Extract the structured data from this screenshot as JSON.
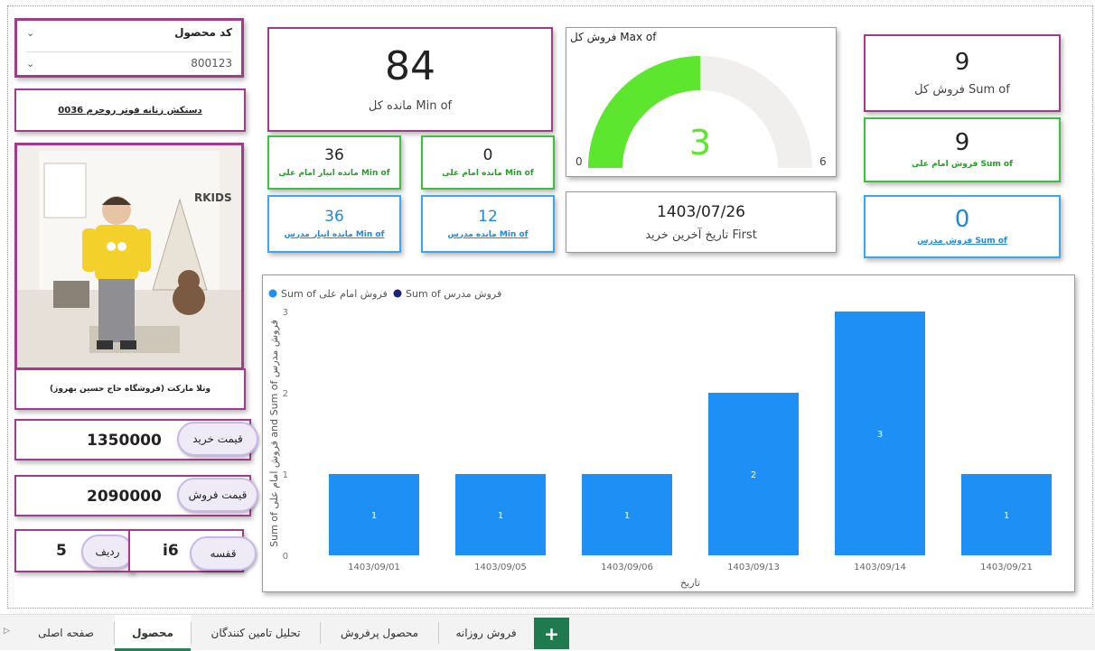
{
  "slicer": {
    "title": "کد محصول",
    "value": "800123"
  },
  "product": {
    "name": "دستکش زنانه فوتر روجرم 0036",
    "caption": "وتلا مارکت (فروشگاه حاج حسین بهروز)",
    "brand_text": "RKIDS"
  },
  "prices": {
    "buy_label": "قیمت خرید",
    "buy_value": "1350000",
    "sell_label": "قیمت فروش",
    "sell_value": "2090000"
  },
  "location": {
    "shelf_label": "قفسه",
    "shelf_value": "i6",
    "row_label": "ردیف",
    "row_value": "5"
  },
  "kpis": {
    "total_stock": {
      "value": "84",
      "label": "Min of مانده کل"
    },
    "stock_warehouse_ali": {
      "value": "36",
      "label": "Min of مانده انبار امام علی"
    },
    "stock_ali": {
      "value": "0",
      "label": "Min of مانده امام علی"
    },
    "stock_warehouse_modarres": {
      "value": "36",
      "label": "Min of مانده انبار مدرس"
    },
    "stock_modarres": {
      "value": "12",
      "label": "Min of مانده مدرس"
    },
    "total_sales": {
      "value": "9",
      "label": "Sum of فروش کل"
    },
    "sales_ali": {
      "value": "9",
      "label": "Sum of فروش امام علی"
    },
    "sales_modarres": {
      "value": "0",
      "label": "Sum of فروش مدرس"
    },
    "last_purchase": {
      "value": "1403/07/26",
      "label": "First تاریخ آخرین خرید"
    }
  },
  "gauge": {
    "title": "Max of فروش کل",
    "value": 3,
    "value_label": "3",
    "min": 0,
    "min_label": "0",
    "max": 6,
    "max_label": "6",
    "fill_color": "#5ce62e",
    "track_color": "#f0efee"
  },
  "chart_data": {
    "type": "bar",
    "legend": [
      {
        "name": "Sum of فروش امام علی",
        "color": "#1e8ff5"
      },
      {
        "name": "Sum of فروش مدرس",
        "color": "#1a237e"
      }
    ],
    "categories": [
      "1403/09/01",
      "1403/09/05",
      "1403/09/06",
      "1403/09/13",
      "1403/09/14",
      "1403/09/21"
    ],
    "series": [
      {
        "name": "Sum of فروش امام علی",
        "values": [
          1,
          1,
          1,
          2,
          3,
          1
        ]
      }
    ],
    "value_labels": [
      "1",
      "1",
      "1",
      "2",
      "3",
      "1"
    ],
    "ylim": [
      0,
      3
    ],
    "yticks": [
      "0",
      "1",
      "2",
      "3"
    ],
    "xlabel": "تاریخ",
    "ylabel": "Sum of فروش امام علی and Sum of فروش مدرس",
    "bar_color": "#1e8ff5"
  },
  "tabs": [
    {
      "label": "صفحه اصلی",
      "active": false
    },
    {
      "label": "محصول",
      "active": true
    },
    {
      "label": "تحلیل تامین کنندگان",
      "active": false
    },
    {
      "label": "محصول پرفروش",
      "active": false
    },
    {
      "label": "فروش روزانه",
      "active": false
    }
  ],
  "add_tab_label": "+"
}
